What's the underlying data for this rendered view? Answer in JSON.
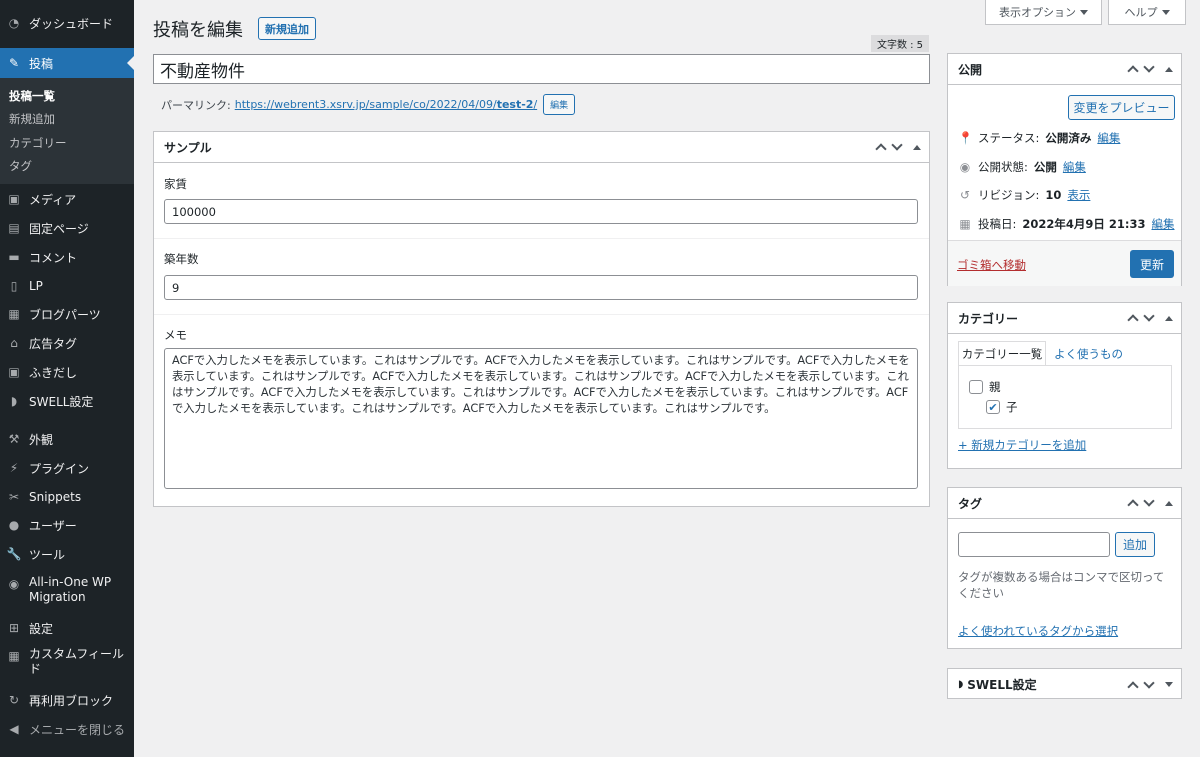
{
  "sidebar": {
    "items": [
      {
        "label": "ダッシュボード",
        "icon": "dashboard-icon"
      },
      {
        "label": "投稿",
        "icon": "pin-icon"
      },
      {
        "label": "メディア",
        "icon": "media-icon"
      },
      {
        "label": "固定ページ",
        "icon": "page-icon"
      },
      {
        "label": "コメント",
        "icon": "comment-icon"
      },
      {
        "label": "LP",
        "icon": "document-icon"
      },
      {
        "label": "ブログパーツ",
        "icon": "blocks-icon"
      },
      {
        "label": "広告タグ",
        "icon": "building-icon"
      },
      {
        "label": "ふきだし",
        "icon": "media-icon"
      },
      {
        "label": "SWELL設定",
        "icon": "swell-icon"
      },
      {
        "label": "外観",
        "icon": "brush-icon"
      },
      {
        "label": "プラグイン",
        "icon": "plugin-icon"
      },
      {
        "label": "Snippets",
        "icon": "snippets-icon"
      },
      {
        "label": "ユーザー",
        "icon": "user-icon"
      },
      {
        "label": "ツール",
        "icon": "wrench-icon"
      },
      {
        "label": "All-in-One WP\nMigration",
        "icon": "migration-icon"
      },
      {
        "label": "設定",
        "icon": "settings-icon"
      },
      {
        "label": "カスタムフィールド",
        "icon": "table-icon"
      },
      {
        "label": "再利用ブロック",
        "icon": "reuse-icon"
      },
      {
        "label": "メニューを閉じる",
        "icon": "collapse-icon"
      }
    ],
    "submenu": [
      "投稿一覧",
      "新規追加",
      "カテゴリー",
      "タグ"
    ]
  },
  "header": {
    "screen_options": "表示オプション",
    "help": "ヘルプ",
    "title": "投稿を編集",
    "new_button": "新規追加"
  },
  "editor": {
    "word_count": "文字数 : 5",
    "post_title": "不動産物件",
    "permalink_label": "パーマリンク:",
    "permalink_base": "https://webrent3.xsrv.jp/sample/co/2022/04/09/",
    "permalink_slug": "test-2",
    "permalink_end": "/",
    "permalink_edit": "編集"
  },
  "acf": {
    "title": "サンプル",
    "rent_label": "家賃",
    "rent_value": "100000",
    "age_label": "築年数",
    "age_value": "9",
    "memo_label": "メモ",
    "memo_value": "ACFで入力したメモを表示しています。これはサンプルです。ACFで入力したメモを表示しています。これはサンプルです。ACFで入力したメモを表示しています。これはサンプルです。ACFで入力したメモを表示しています。これはサンプルです。ACFで入力したメモを表示しています。これはサンプルです。ACFで入力したメモを表示しています。これはサンプルです。ACFで入力したメモを表示しています。これはサンプルです。ACFで入力したメモを表示しています。これはサンプルです。ACFで入力したメモを表示しています。これはサンプルです。"
  },
  "publish": {
    "title": "公開",
    "preview": "変更をプレビュー",
    "status_label": "ステータス:",
    "status_value": "公開済み",
    "visibility_label": "公開状態:",
    "visibility_value": "公開",
    "revision_label": "リビジョン:",
    "revision_value": "10",
    "revision_link": "表示",
    "date_label": "投稿日:",
    "date_value": "2022年4月9日 21:33",
    "edit": "編集",
    "trash": "ゴミ箱へ移動",
    "update": "更新"
  },
  "category": {
    "title": "カテゴリー",
    "tab_all": "カテゴリー一覧",
    "tab_popular": "よく使うもの",
    "items": [
      {
        "label": "親",
        "checked": false
      },
      {
        "label": "子",
        "checked": true
      }
    ],
    "add_link": "+ 新規カテゴリーを追加"
  },
  "tags": {
    "title": "タグ",
    "add_button": "追加",
    "help": "タグが複数ある場合はコンマで区切ってください",
    "choose_link": "よく使われているタグから選択"
  },
  "swell": {
    "title": "SWELL設定"
  }
}
